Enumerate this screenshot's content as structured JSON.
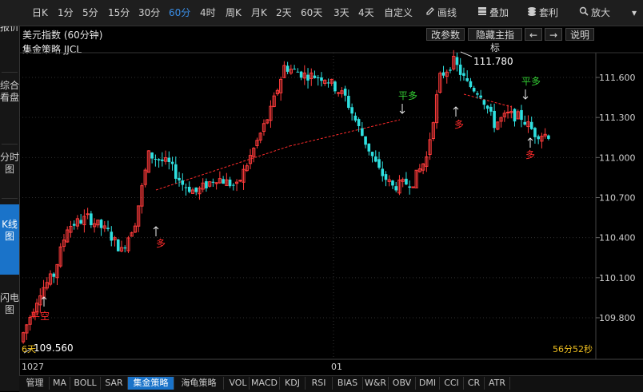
{
  "toolbar": {
    "periods": [
      "日K",
      "1分",
      "5分",
      "15分",
      "30分",
      "60分",
      "4时",
      "周K",
      "月K",
      "2天",
      "60天",
      "3天",
      "4天",
      "自定义"
    ],
    "active_period": "60分",
    "tools": [
      {
        "label": "画线",
        "icon": "pencil-icon"
      },
      {
        "label": "叠加",
        "icon": "stack-icon"
      },
      {
        "label": "套利",
        "icon": "coins-icon"
      },
      {
        "label": "放大",
        "icon": "magnify-icon"
      }
    ],
    "more_glyph": "▾"
  },
  "sidebar": {
    "tabs": [
      "行情报价",
      "综合看盘",
      "分时图",
      "K线图",
      "闪电图"
    ],
    "active": "K线图"
  },
  "header": {
    "title": "美元指数 (60分钟)",
    "strategy": "集金策略 JJCL",
    "buttons": [
      "改参数",
      "隐藏主指标"
    ],
    "left_arrow": "←",
    "right_arrow": "→",
    "help": "说明"
  },
  "chart": {
    "y_ticks": [
      "111.600",
      "111.300",
      "111.000",
      "110.700",
      "110.400",
      "110.100",
      "109.800"
    ],
    "x_labels": [
      "1027",
      "01"
    ],
    "high_label": "111.780",
    "low_label": "109.560",
    "corner_label": "6天",
    "countdown": "56分52秒",
    "signals": [
      {
        "text": "多",
        "color": "#ff2b2b"
      },
      {
        "text": "多",
        "color": "#ff2b2b"
      },
      {
        "text": "平多",
        "color": "#33cc33"
      },
      {
        "text": "多",
        "color": "#ff2b2b"
      },
      {
        "text": "平多",
        "color": "#33cc33"
      },
      {
        "text": "多",
        "color": "#ff2b2b"
      },
      {
        "text": "平空",
        "color": "#ff2b2b"
      }
    ],
    "up_color": "#ff3b3b",
    "down_color": "#2ee0e0"
  },
  "bottom_tabs": [
    "管理",
    "MA",
    "BOLL",
    "SAR",
    "集金策略",
    "海龟策略",
    "VOL",
    "MACD",
    "KDJ",
    "RSI",
    "BIAS",
    "W&R",
    "OBV",
    "DMI",
    "CCI",
    "CR",
    "ATR"
  ],
  "bottom_active": "集金策略"
}
